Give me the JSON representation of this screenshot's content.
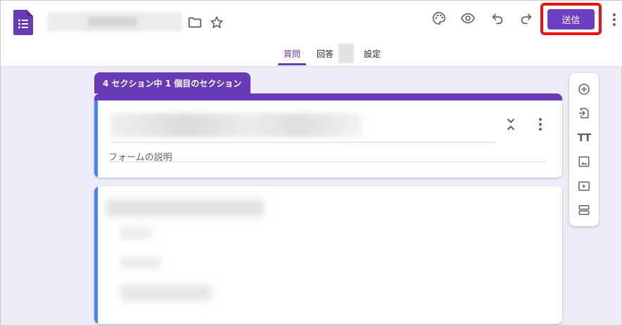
{
  "header": {
    "send_label": "送信"
  },
  "tabs": [
    {
      "label": "質問",
      "active": true
    },
    {
      "label": "回答"
    },
    {
      "label": "設定"
    }
  ],
  "section": {
    "label": "4 セクション中 1 個目のセクション"
  },
  "form": {
    "description_placeholder": "フォームの説明"
  },
  "icons": {
    "app": "google-forms-icon",
    "toolbar": [
      "folder-icon",
      "star-icon",
      "palette-icon",
      "preview-eye-icon",
      "undo-icon",
      "redo-icon",
      "more-vert-icon"
    ],
    "side": [
      "add-question-icon",
      "import-questions-icon",
      "add-title-icon",
      "add-image-icon",
      "add-video-icon",
      "add-section-icon"
    ]
  },
  "colors": {
    "accent": "#673ab7",
    "send_button": "#6d3fc0",
    "highlight_frame": "#ee1111",
    "background": "#efeaf7",
    "left_accent": "#4285f4"
  }
}
